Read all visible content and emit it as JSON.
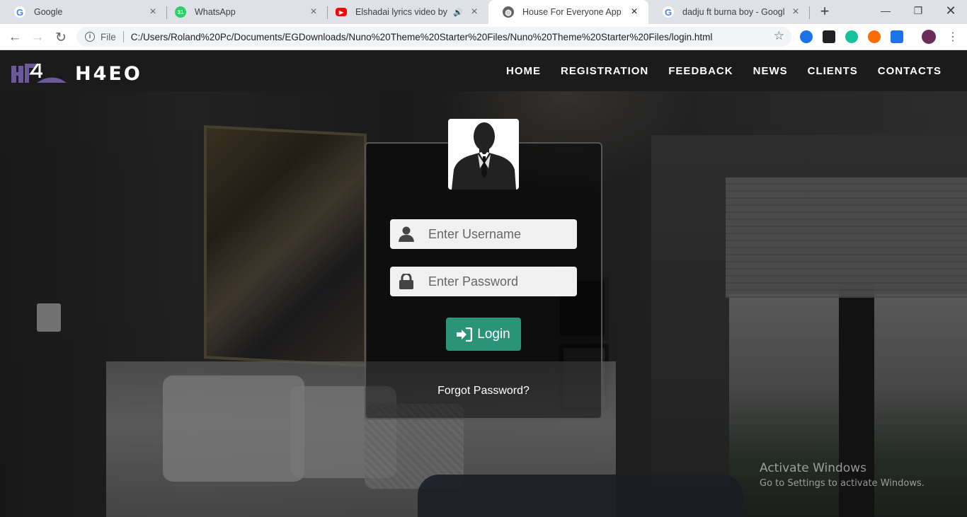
{
  "browser": {
    "tabs": [
      {
        "title": "Google",
        "favicon": "google-icon",
        "color": "#4285f4",
        "active": false
      },
      {
        "title": "WhatsApp",
        "favicon": "whatsapp-icon",
        "badge": "31",
        "color": "#25d366",
        "active": false
      },
      {
        "title": "Elshadai lyrics video by H-C",
        "favicon": "youtube-icon",
        "color": "#ff0000",
        "active": false
      },
      {
        "title": "House For Everyone App",
        "favicon": "globe-icon",
        "color": "#5f6368",
        "active": true
      },
      {
        "title": "dadju ft burna boy - Google Se",
        "favicon": "google-icon",
        "color": "#4285f4",
        "active": false
      }
    ],
    "address": {
      "scheme": "File",
      "url": "C:/Users/Roland%20Pc/Documents/EGDownloads/Nuno%20Theme%20Starter%20Files/Nuno%20Theme%20Starter%20Files/login.html"
    }
  },
  "site": {
    "logo_text": "H4EO",
    "nav": [
      "HOME",
      "REGISTRATION",
      "FEEDBACK",
      "NEWS",
      "CLIENTS",
      "CONTACTS"
    ]
  },
  "login": {
    "username_placeholder": "Enter Username",
    "password_placeholder": "Enter Password",
    "button_label": "Login",
    "forgot_label": "Forgot Password?",
    "accent": "#2a9378"
  },
  "watermark": {
    "line1": "Activate Windows",
    "line2": "Go to Settings to activate Windows."
  }
}
